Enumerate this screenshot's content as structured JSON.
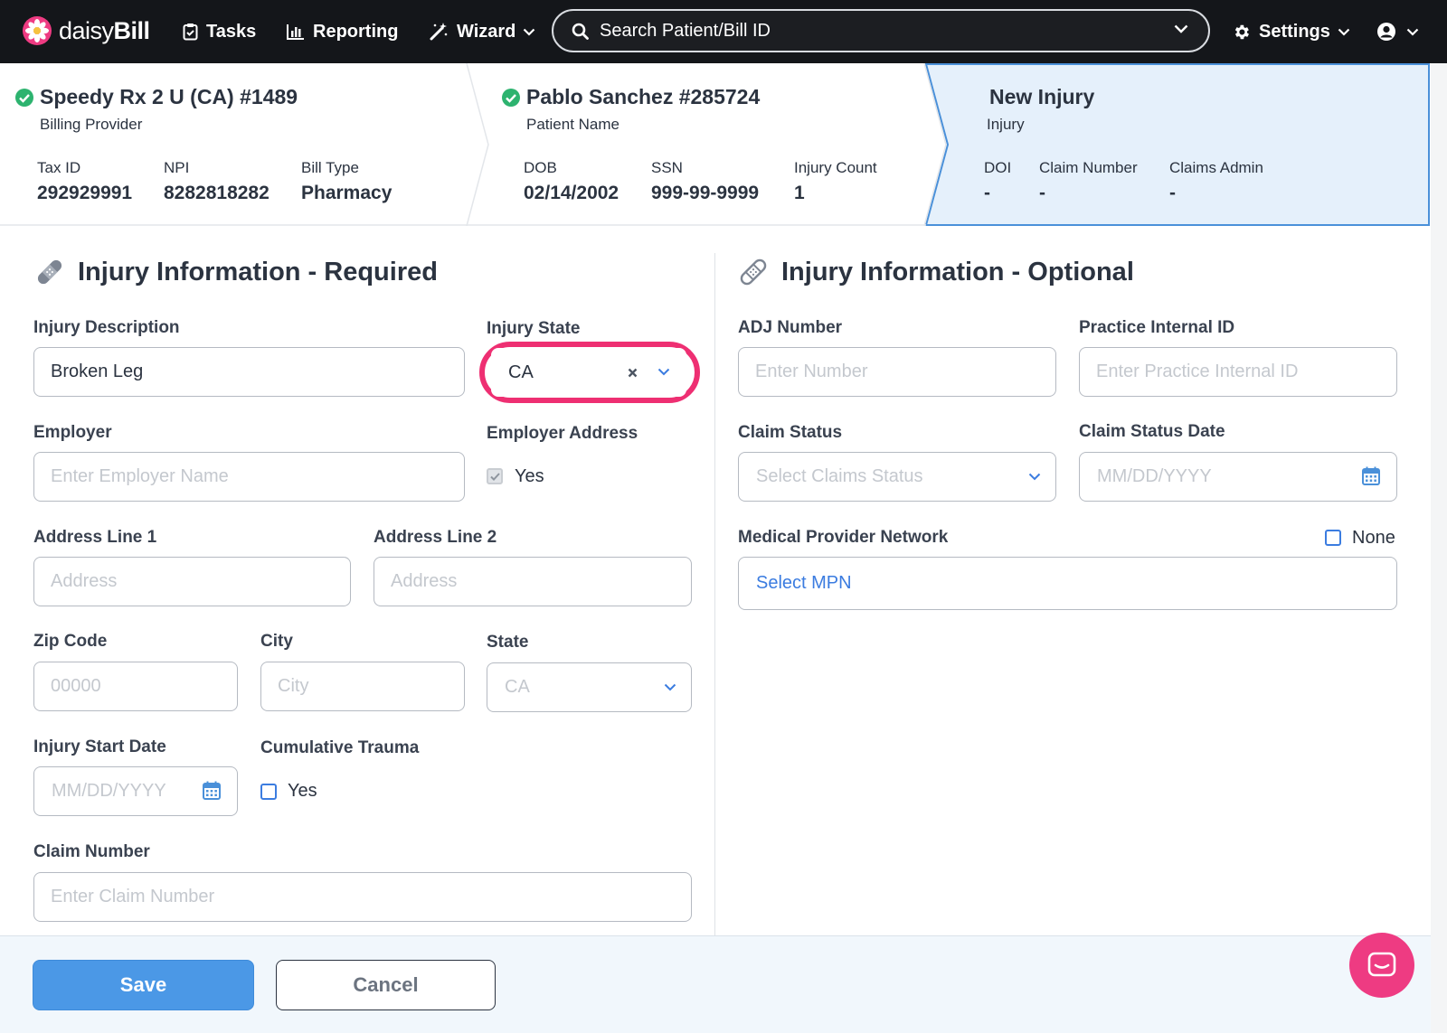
{
  "navbar": {
    "logo_thin": "daisy",
    "logo_bold": "Bill",
    "tasks": "Tasks",
    "reporting": "Reporting",
    "wizard": "Wizard",
    "search_placeholder": "Search Patient/Bill ID",
    "settings": "Settings"
  },
  "billing_provider": {
    "title": "Speedy Rx 2 U (CA) #1489",
    "subtitle": "Billing Provider",
    "fields": [
      {
        "label": "Tax ID",
        "value": "292929991"
      },
      {
        "label": "NPI",
        "value": "8282818282"
      },
      {
        "label": "Bill Type",
        "value": "Pharmacy"
      }
    ]
  },
  "patient": {
    "title": "Pablo Sanchez #285724",
    "subtitle": "Patient Name",
    "fields": [
      {
        "label": "DOB",
        "value": "02/14/2002"
      },
      {
        "label": "SSN",
        "value": "999-99-9999"
      },
      {
        "label": "Injury Count",
        "value": "1"
      }
    ]
  },
  "injury": {
    "title": "New Injury",
    "subtitle": "Injury",
    "fields": [
      {
        "label": "DOI",
        "value": "-"
      },
      {
        "label": "Claim Number",
        "value": "-"
      },
      {
        "label": "Claims Admin",
        "value": "-"
      }
    ]
  },
  "required": {
    "title": "Injury Information - Required",
    "injury_description_label": "Injury Description",
    "injury_description_value": "Broken Leg",
    "injury_state_label": "Injury State",
    "injury_state_value": "CA",
    "employer_label": "Employer",
    "employer_placeholder": "Enter Employer Name",
    "employer_address_label": "Employer Address",
    "employer_address_checkbox": "Yes",
    "address1_label": "Address Line 1",
    "address1_placeholder": "Address",
    "address2_label": "Address Line 2",
    "address2_placeholder": "Address",
    "zip_label": "Zip Code",
    "zip_placeholder": "00000",
    "city_label": "City",
    "city_placeholder": "City",
    "state_label": "State",
    "state_placeholder": "CA",
    "injury_start_label": "Injury Start Date",
    "injury_start_placeholder": "MM/DD/YYYY",
    "cumulative_label": "Cumulative Trauma",
    "cumulative_checkbox": "Yes",
    "claim_number_label": "Claim Number",
    "claim_number_placeholder": "Enter Claim Number"
  },
  "optional": {
    "title": "Injury Information - Optional",
    "adj_label": "ADJ Number",
    "adj_placeholder": "Enter Number",
    "practice_id_label": "Practice Internal ID",
    "practice_id_placeholder": "Enter Practice Internal ID",
    "claim_status_label": "Claim Status",
    "claim_status_placeholder": "Select Claims Status",
    "claim_status_date_label": "Claim Status Date",
    "claim_status_date_placeholder": "MM/DD/YYYY",
    "mpn_label": "Medical Provider Network",
    "mpn_none": "None",
    "mpn_placeholder": "Select MPN"
  },
  "footer": {
    "save": "Save",
    "cancel": "Cancel"
  },
  "colors": {
    "navbar": "#14161a",
    "accent": "#4b98e6",
    "highlight": "#ee2f72",
    "check_green": "#2db36f",
    "active_crumb_bg": "#e5f0fb"
  }
}
